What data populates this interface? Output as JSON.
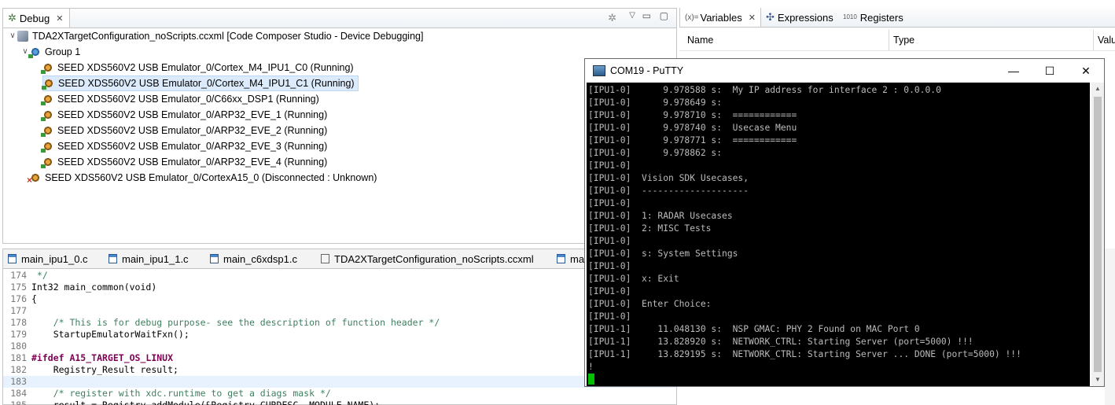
{
  "debug": {
    "tab_label": "Debug",
    "tree": [
      {
        "label": "TDA2XTargetConfiguration_noScripts.ccxml [Code Composer Studio - Device Debugging]",
        "kind": "root",
        "level": 0,
        "twisty": "∨"
      },
      {
        "label": "Group 1",
        "kind": "group",
        "level": 1,
        "twisty": "∨"
      },
      {
        "label": "SEED XDS560V2 USB Emulator_0/Cortex_M4_IPU1_C0 (Running)",
        "kind": "thread",
        "level": 2
      },
      {
        "label": "SEED XDS560V2 USB Emulator_0/Cortex_M4_IPU1_C1 (Running)",
        "kind": "thread",
        "level": 2,
        "selected": true
      },
      {
        "label": "SEED XDS560V2 USB Emulator_0/C66xx_DSP1 (Running)",
        "kind": "thread",
        "level": 2
      },
      {
        "label": "SEED XDS560V2 USB Emulator_0/ARP32_EVE_1 (Running)",
        "kind": "thread",
        "level": 2
      },
      {
        "label": "SEED XDS560V2 USB Emulator_0/ARP32_EVE_2 (Running)",
        "kind": "thread",
        "level": 2
      },
      {
        "label": "SEED XDS560V2 USB Emulator_0/ARP32_EVE_3 (Running)",
        "kind": "thread",
        "level": 2
      },
      {
        "label": "SEED XDS560V2 USB Emulator_0/ARP32_EVE_4 (Running)",
        "kind": "thread",
        "level": 2
      },
      {
        "label": "SEED XDS560V2 USB Emulator_0/CortexA15_0 (Disconnected : Unknown)",
        "kind": "disc",
        "level": 1
      }
    ]
  },
  "vars": {
    "tabs": [
      "Variables",
      "Expressions",
      "Registers"
    ],
    "tab_prefixes": [
      "(x)=",
      "",
      "1010"
    ],
    "columns": [
      "Name",
      "Type",
      "Valu"
    ]
  },
  "editor": {
    "tabs": [
      "main_ipu1_0.c",
      "main_ipu1_1.c",
      "main_c6xdsp1.c",
      "TDA2XTargetConfiguration_noScripts.ccxml",
      "ma"
    ],
    "lines": [
      {
        "n": "174",
        "text": " */",
        "cls": "cmt"
      },
      {
        "n": "175",
        "text": "Int32 main_common(void)",
        "cls": ""
      },
      {
        "n": "176",
        "text": "{",
        "cls": ""
      },
      {
        "n": "177",
        "text": "",
        "cls": ""
      },
      {
        "n": "178",
        "text": "    /* This is for debug purpose- see the description of function header */",
        "cls": "cmt"
      },
      {
        "n": "179",
        "text": "    StartupEmulatorWaitFxn();",
        "cls": ""
      },
      {
        "n": "180",
        "text": "",
        "cls": ""
      },
      {
        "n": "181",
        "text": "#ifdef A15_TARGET_OS_LINUX",
        "cls": "pp"
      },
      {
        "n": "182",
        "text": "    Registry_Result result;",
        "cls": ""
      },
      {
        "n": "183",
        "text": "",
        "cls": "",
        "current": true
      },
      {
        "n": "184",
        "text": "    /* register with xdc.runtime to get a diags mask */",
        "cls": "cmt"
      },
      {
        "n": "185",
        "text": "    result = Registry_addModule(&Registry_CURDESC, MODULE_NAME);",
        "cls": ""
      }
    ]
  },
  "putty": {
    "title": "COM19 - PuTTY",
    "lines": [
      "[IPU1-0]      9.978588 s:  My IP address for interface 2 : 0.0.0.0",
      "[IPU1-0]      9.978649 s:",
      "[IPU1-0]      9.978710 s:  ============",
      "[IPU1-0]      9.978740 s:  Usecase Menu",
      "[IPU1-0]      9.978771 s:  ============",
      "[IPU1-0]      9.978862 s:",
      "[IPU1-0]",
      "[IPU1-0]  Vision SDK Usecases,",
      "[IPU1-0]  --------------------",
      "[IPU1-0]",
      "[IPU1-0]  1: RADAR Usecases",
      "[IPU1-0]  2: MISC Tests",
      "[IPU1-0]",
      "[IPU1-0]  s: System Settings",
      "[IPU1-0]",
      "[IPU1-0]  x: Exit",
      "[IPU1-0]",
      "[IPU1-0]  Enter Choice:",
      "[IPU1-0]",
      "[IPU1-1]     11.048130 s:  NSP GMAC: PHY 2 Found on MAC Port 0",
      "[IPU1-1]     13.828920 s:  NETWORK_CTRL: Starting Server (port=5000) !!!",
      "[IPU1-1]     13.829195 s:  NETWORK_CTRL: Starting Server ... DONE (port=5000) !!!",
      "!"
    ]
  }
}
